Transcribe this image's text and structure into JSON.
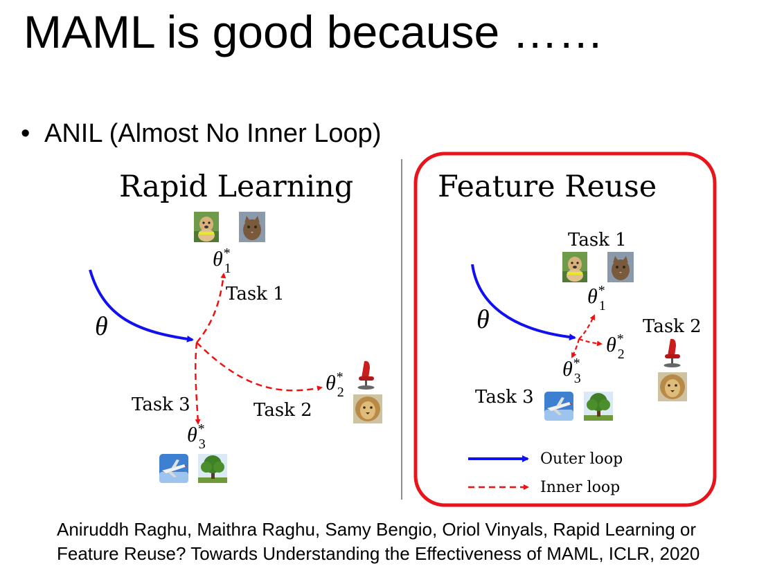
{
  "slide": {
    "title": "MAML is good because ……",
    "bullet": "ANIL (Almost No Inner Loop)"
  },
  "left_panel": {
    "title": "Rapid Learning",
    "theta_label": "θ",
    "task1_label": "Task 1",
    "task2_label": "Task 2",
    "task3_label": "Task 3",
    "theta1": {
      "base": "θ",
      "sup": "*",
      "sub": "1"
    },
    "theta2": {
      "base": "θ",
      "sup": "*",
      "sub": "2"
    },
    "theta3": {
      "base": "θ",
      "sup": "*",
      "sub": "3"
    }
  },
  "right_panel": {
    "title": "Feature Reuse",
    "theta_label": "θ",
    "task1_label": "Task 1",
    "task2_label": "Task 2",
    "task3_label": "Task 3",
    "theta1": {
      "base": "θ",
      "sup": "*",
      "sub": "1"
    },
    "theta2": {
      "base": "θ",
      "sup": "*",
      "sub": "2"
    },
    "theta3": {
      "base": "θ",
      "sup": "*",
      "sub": "3"
    },
    "legend": {
      "outer_loop": "Outer loop",
      "inner_loop": "Inner loop"
    }
  },
  "colors": {
    "outer_loop": "#1010f0",
    "inner_loop": "#f01010",
    "highlight_box": "#e8141a",
    "divider": "#666666"
  },
  "icons": [
    "dog-image-icon",
    "cat-image-icon",
    "chair-icon",
    "lion-image-icon",
    "airplane-image-icon",
    "tree-image-icon"
  ],
  "citation": {
    "line1": "Aniruddh Raghu, Maithra Raghu, Samy Bengio, Oriol Vinyals, Rapid Learning or",
    "line2": "Feature Reuse? Towards Understanding the Effectiveness of MAML, ICLR, 2020"
  }
}
